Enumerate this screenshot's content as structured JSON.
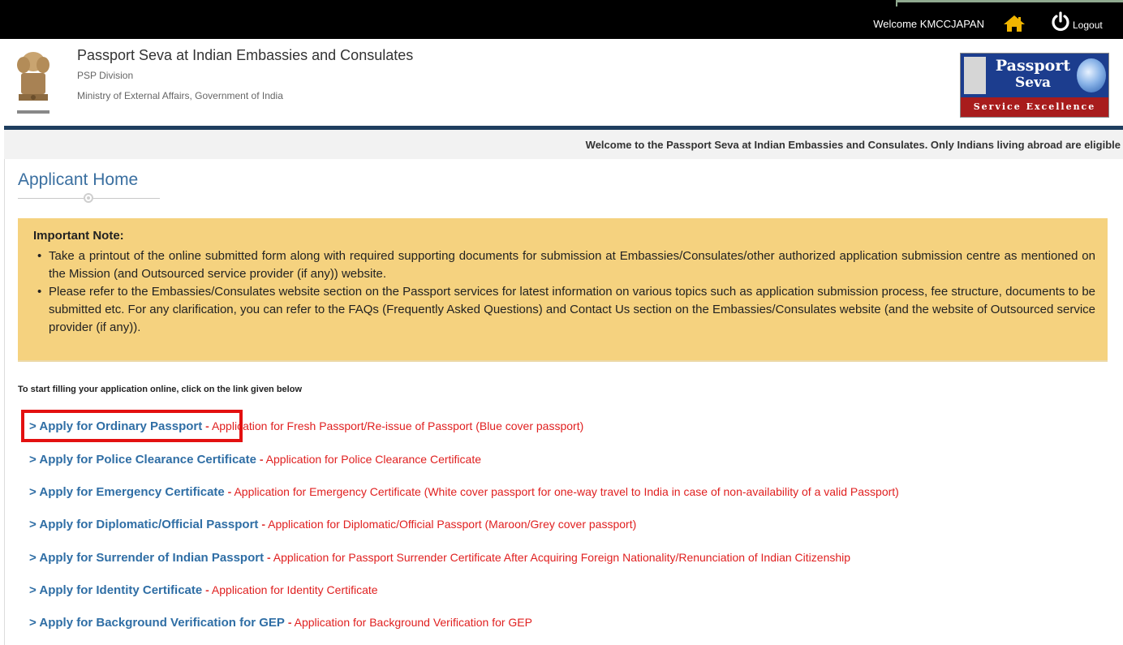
{
  "topbar": {
    "welcome": "Welcome KMCCJAPAN",
    "home_icon": "home-icon",
    "power_icon": "power-icon",
    "logout_label": "Logout",
    "home_color": "#f0b400"
  },
  "header": {
    "title": "Passport Seva at Indian Embassies and Consulates",
    "subtitle1": "PSP Division",
    "subtitle2": "Ministry of External Affairs, Government of India",
    "logo_word1": "Passport",
    "logo_word2": "Seva",
    "logo_tagline": "Service Excellence"
  },
  "marquee": "Welcome to the Passport Seva at Indian Embassies and Consulates. Only Indians living abroad are eligible",
  "page": {
    "title": "Applicant Home"
  },
  "note": {
    "heading": "Important Note:",
    "items": [
      "Take a printout of the online submitted form along with required supporting documents for submission at Embassies/Consulates/other authorized application submission centre as mentioned on the Mission (and Outsourced service provider (if any)) website.",
      "Please refer to the Embassies/Consulates website section on the Passport services for latest information on various topics such as application submission process, fee structure, documents to be submitted etc. For any clarification, you can refer to the FAQs (Frequently Asked Questions) and Contact Us section on the Embassies/Consulates website (and the website of Outsourced service provider (if any))."
    ]
  },
  "instructions": "To start filling your application online, click on the link given below",
  "links": [
    {
      "label": "> Apply for Ordinary Passport",
      "separator": "-",
      "desc": "Application for Fresh Passport/Re-issue of Passport (Blue cover passport)"
    },
    {
      "label": "> Apply for Police Clearance Certificate",
      "separator": "-",
      "desc": "Application for Police Clearance Certificate"
    },
    {
      "label": "> Apply for Emergency Certificate",
      "separator": "-",
      "desc": "Application for Emergency Certificate (White cover passport for one-way travel to India in case of non-availability of a valid Passport)"
    },
    {
      "label": "> Apply for Diplomatic/Official Passport",
      "separator": "-",
      "desc": "Application for Diplomatic/Official Passport (Maroon/Grey cover passport)"
    },
    {
      "label": "> Apply for Surrender of Indian Passport",
      "separator": "-",
      "desc": "Application for Passport Surrender Certificate After Acquiring Foreign Nationality/Renunciation of Indian Citizenship"
    },
    {
      "label": "> Apply for Identity Certificate",
      "separator": "-",
      "desc": "Application for Identity Certificate"
    },
    {
      "label": "> Apply for Background Verification for GEP",
      "separator": "-",
      "desc": "Application for Background Verification for GEP"
    }
  ],
  "colors": {
    "link": "#2f6ea5",
    "desc": "#e02020",
    "note_bg": "#f5d27f",
    "highlight": "#e31010",
    "navline": "#1f3e5f"
  }
}
